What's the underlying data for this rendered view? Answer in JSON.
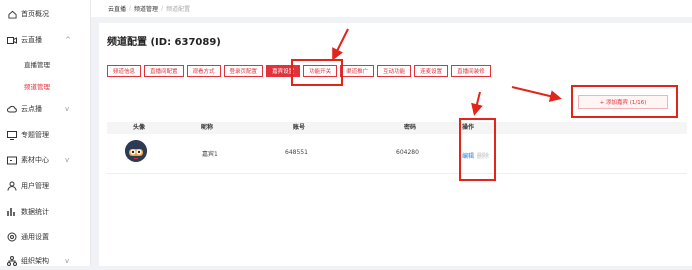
{
  "sidebar": {
    "items": [
      {
        "label": "首页概况",
        "icon": "home-icon"
      },
      {
        "label": "云直播",
        "icon": "video-icon",
        "expanded": true,
        "children": [
          {
            "label": "直播管理"
          },
          {
            "label": "频道管理",
            "active": true
          }
        ]
      },
      {
        "label": "云点播",
        "icon": "cloud-icon"
      },
      {
        "label": "专题管理",
        "icon": "monitor-icon"
      },
      {
        "label": "素材中心",
        "icon": "folder-icon"
      },
      {
        "label": "用户管理",
        "icon": "user-icon"
      },
      {
        "label": "数据统计",
        "icon": "chart-icon"
      },
      {
        "label": "通用设置",
        "icon": "settings-icon"
      },
      {
        "label": "组织架构",
        "icon": "org-icon"
      }
    ]
  },
  "breadcrumb": [
    "云直播",
    "频道管理",
    "频道配置"
  ],
  "page": {
    "title": "频道配置 (ID: 637089)"
  },
  "tabs": [
    "频道信息",
    "直播间配置",
    "观看方式",
    "登录页配置",
    "嘉宾设置",
    "功能开关",
    "渠道推广",
    "互动功能",
    "连麦设置",
    "直播间装修"
  ],
  "active_tab": "嘉宾设置",
  "add_button": {
    "label": "+ 添加嘉宾 (1/16)"
  },
  "table": {
    "columns": [
      "头像",
      "昵称",
      "账号",
      "密码",
      "操作"
    ],
    "rows": [
      {
        "nickname": "嘉宾1",
        "account": "648551",
        "password": "604280",
        "edit": "编辑",
        "delete": "删除"
      }
    ]
  },
  "colors": {
    "accent": "#e2323b",
    "annotation": "#e1251b",
    "link": "#2d7bd8"
  }
}
